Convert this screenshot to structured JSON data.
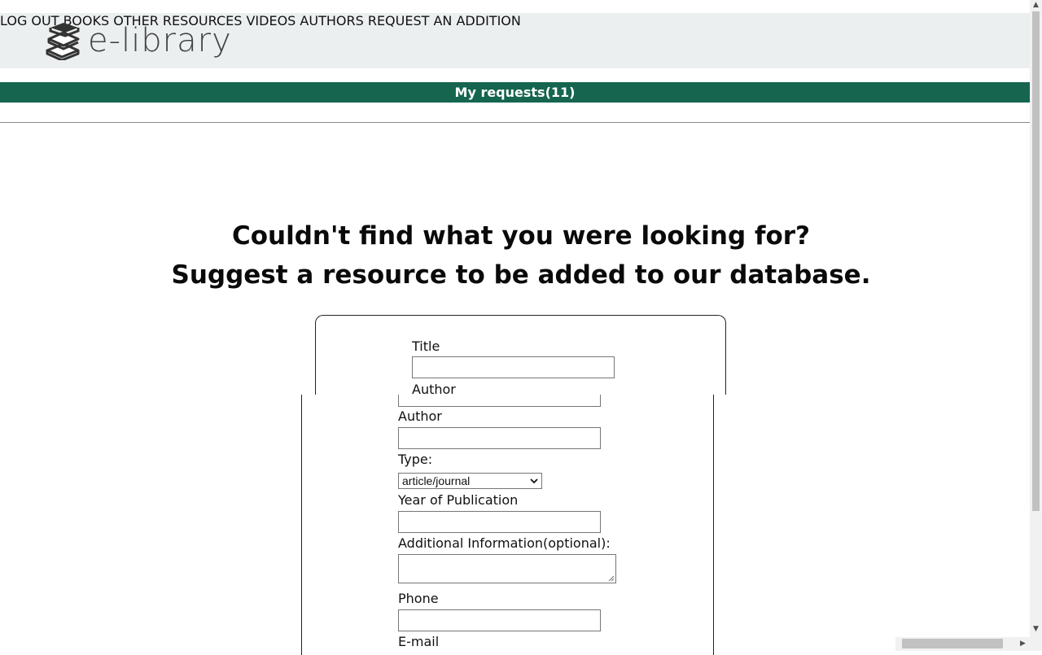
{
  "brand": {
    "logo_text": "e-library"
  },
  "nav": {
    "logout": "LOG OUT",
    "books": "BOOKS",
    "other": "OTHER RESOURCES",
    "videos": "VIDEOS",
    "authors": "AUTHORS",
    "request": "REQUEST AN ADDITION"
  },
  "requests_bar": "My requests(11)",
  "headline": {
    "line1": "Couldn't find what you were looking for?",
    "line2": "Suggest a resource to be added to our database."
  },
  "form": {
    "card_title_label": "Title",
    "card_author_label": "Author",
    "author_label": "Author",
    "type_label": "Type:",
    "type_selected": "article/journal",
    "year_label": "Year of Publication",
    "additional_label": "Additional Information(optional):",
    "phone_label": "Phone",
    "email_label": "E-mail"
  },
  "icons": {
    "logo": "books-stack-icon",
    "select_caret": "chevron-down-icon",
    "scroll_up": "arrow-up-icon",
    "scroll_down": "arrow-down-icon",
    "scroll_right": "arrow-right-icon"
  },
  "colors": {
    "header_bg": "#eceff0",
    "accent_green": "#15654f"
  }
}
